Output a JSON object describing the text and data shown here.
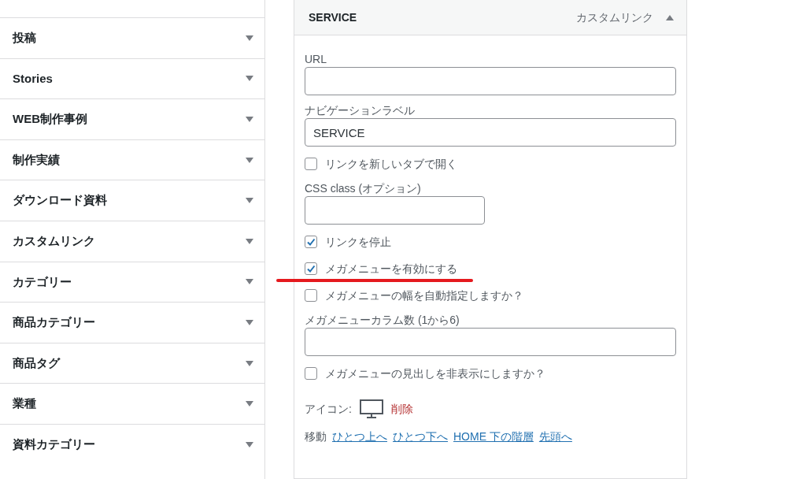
{
  "sidebar": {
    "items": [
      {
        "label": "投稿",
        "expanded": false
      },
      {
        "label": "Stories",
        "expanded": false
      },
      {
        "label": "WEB制作事例",
        "expanded": false
      },
      {
        "label": "制作実績",
        "expanded": false
      },
      {
        "label": "ダウンロード資料",
        "expanded": false
      },
      {
        "label": "カスタムリンク",
        "expanded": false
      },
      {
        "label": "カテゴリー",
        "expanded": false
      },
      {
        "label": "商品カテゴリー",
        "expanded": false
      },
      {
        "label": "商品タグ",
        "expanded": false
      },
      {
        "label": "業種",
        "expanded": false
      },
      {
        "label": "資料カテゴリー",
        "expanded": false
      }
    ]
  },
  "menu_item": {
    "title": "SERVICE",
    "type_label": "カスタムリンク",
    "expanded": true,
    "fields": [
      {
        "kind": "text",
        "label": "URL"
      },
      {
        "kind": "text",
        "label": "ナビゲーションラベル",
        "value": "SERVICE"
      },
      {
        "kind": "checkbox",
        "label": "リンクを新しいタブで開く",
        "checked": false
      },
      {
        "kind": "short_text",
        "label": "CSS class (オプション)"
      },
      {
        "kind": "checkbox",
        "label": "リンクを停止",
        "checked": true
      },
      {
        "kind": "checkbox",
        "label": "メガメニューを有効にする",
        "checked": true,
        "highlighted": true
      },
      {
        "kind": "checkbox",
        "label": "メガメニューの幅を自動指定しますか？",
        "checked": false
      },
      {
        "kind": "text",
        "label": "メガメニューカラム数 (1から6)"
      },
      {
        "kind": "checkbox",
        "label": "メガメニューの見出しを非表示にしますか？",
        "checked": false
      }
    ],
    "icon_row": {
      "label": "アイコン:",
      "remove": "削除"
    },
    "move": {
      "label": "移動",
      "links": [
        "ひとつ上へ",
        "ひとつ下へ",
        "HOME 下の階層",
        "先頭へ"
      ]
    }
  }
}
